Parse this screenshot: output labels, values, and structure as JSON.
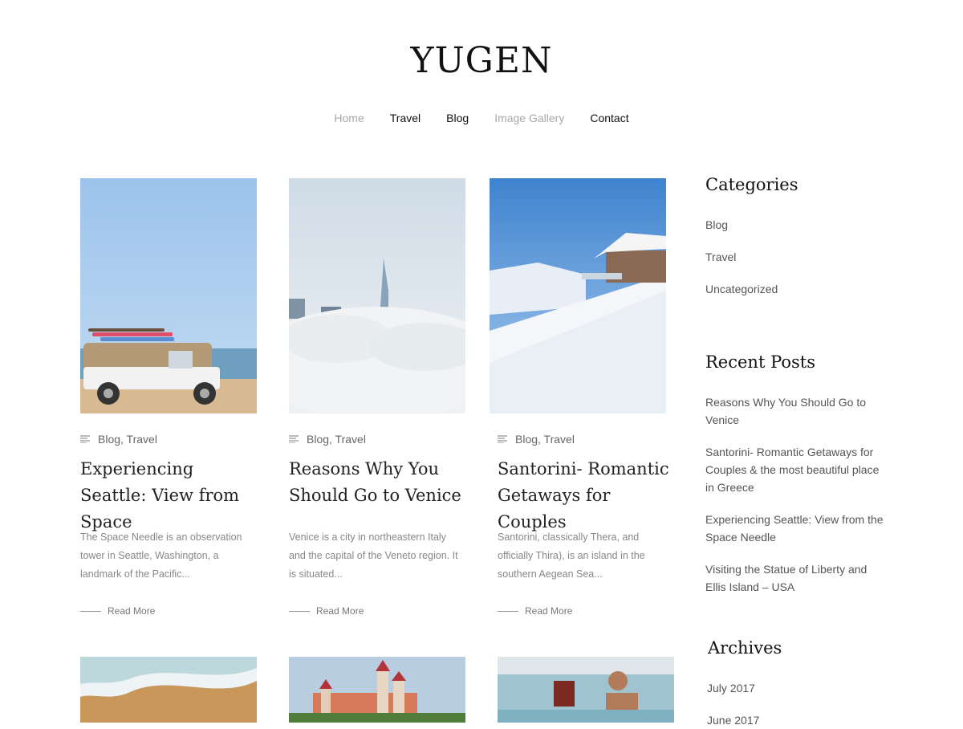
{
  "site": {
    "title": "YUGEN"
  },
  "nav": [
    {
      "label": "Home"
    },
    {
      "label": "Travel"
    },
    {
      "label": "Blog"
    },
    {
      "label": "Image Gallery"
    },
    {
      "label": "Contact"
    }
  ],
  "posts": [
    {
      "categories": "Blog, Travel",
      "title": "Experiencing Seattle: View from Space",
      "excerpt": "The Space Needle is an observation tower in Seattle, Washington, a landmark of the Pacific...",
      "read_more": "Read More"
    },
    {
      "categories": "Blog, Travel",
      "title": "Reasons Why You Should Go to Venice",
      "excerpt": "Venice is a city in northeastern Italy and the capital of the Veneto region. It is situated...",
      "read_more": "Read More"
    },
    {
      "categories": "Blog, Travel",
      "title": "Santorini- Romantic Getaways for Couples",
      "excerpt": "Santorini, classically Thera, and officially Thira), is an island in the southern Aegean Sea...",
      "read_more": "Read More"
    }
  ],
  "sidebar": {
    "categories": {
      "title": "Categories",
      "items": [
        "Blog",
        "Travel",
        "Uncategorized"
      ]
    },
    "recent_posts": {
      "title": "Recent Posts",
      "items": [
        "Reasons Why You Should Go to Venice",
        "Santorini- Romantic Getaways for Couples & the most beautiful place in Greece",
        "Experiencing Seattle: View from the Space Needle",
        "Visiting the Statue of Liberty and Ellis Island – USA"
      ]
    },
    "archives": {
      "title": "Archives",
      "items": [
        "July 2017",
        "June 2017"
      ]
    }
  },
  "colors": {
    "text": "#333333",
    "muted_nav": "#a8a8a8",
    "excerpt": "#888888",
    "sky": "#a9c9ec"
  }
}
